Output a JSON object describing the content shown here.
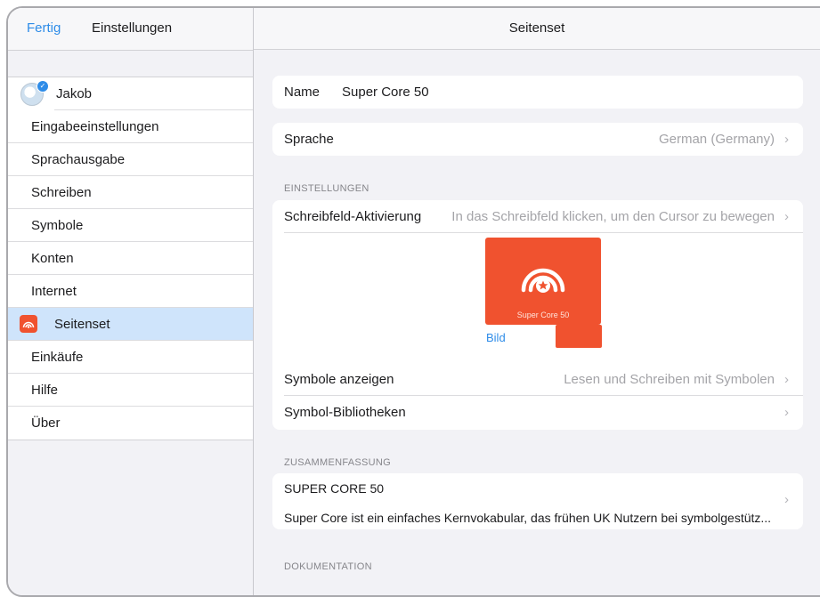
{
  "sidebar": {
    "done_label": "Fertig",
    "title": "Einstellungen",
    "user_name": "Jakob",
    "items": [
      {
        "label": "Eingabeeinstellungen"
      },
      {
        "label": "Sprachausgabe"
      },
      {
        "label": "Schreiben"
      },
      {
        "label": "Symbole"
      },
      {
        "label": "Konten"
      },
      {
        "label": "Internet"
      },
      {
        "label": "Seitenset",
        "selected": true,
        "icon": "pageset-icon"
      },
      {
        "label": "Einkäufe"
      },
      {
        "label": "Hilfe"
      },
      {
        "label": "Über"
      }
    ]
  },
  "detail": {
    "title": "Seitenset",
    "name_label": "Name",
    "name_value": "Super Core 50",
    "language_label": "Sprache",
    "language_value": "German (Germany)",
    "settings_section": "EINSTELLUNGEN",
    "activation_label": "Schreibfeld-Aktivierung",
    "activation_value": "In das Schreibfeld klicken, um den Cursor zu bewegen",
    "tile_caption": "Super Core 50",
    "image_link": "Bild",
    "show_symbols_label": "Symbole anzeigen",
    "show_symbols_value": "Lesen und Schreiben mit Symbolen",
    "libraries_label": "Symbol-Bibliotheken",
    "summary_section": "ZUSAMMENFASSUNG",
    "summary_title": "SUPER CORE 50",
    "summary_text": "Super Core ist ein einfaches Kernvokabular, das frühen UK Nutzern bei symbolgestütz...",
    "docs_section": "DOKUMENTATION"
  },
  "colors": {
    "accent": "#2e8ce8",
    "brand": "#f0522f",
    "selection": "#cfe4fb"
  }
}
